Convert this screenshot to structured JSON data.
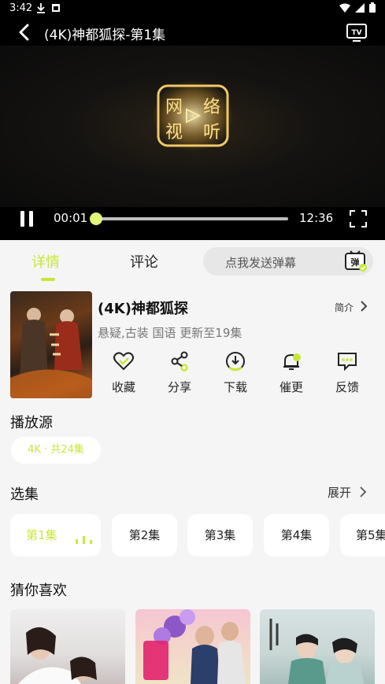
{
  "status_bar": {
    "time": "3:42"
  },
  "player": {
    "title": "(4K)神都狐探-第1集",
    "logo_text": "网络视听",
    "current_time": "00:01",
    "duration": "12:36",
    "progress": 0.002
  },
  "tabs": {
    "details": "详情",
    "comments": "评论",
    "danmu_placeholder": "点我发送弹幕",
    "danmu_icon_text": "弹"
  },
  "show": {
    "title": "(4K)神都狐探",
    "intro_label": "简介",
    "tags": "悬疑,古装 国语 更新至19集",
    "actions": [
      {
        "label": "收藏",
        "icon": "heart-icon"
      },
      {
        "label": "分享",
        "icon": "share-icon"
      },
      {
        "label": "下载",
        "icon": "download-icon"
      },
      {
        "label": "催更",
        "icon": "bell-icon"
      },
      {
        "label": "反馈",
        "icon": "feedback-icon"
      }
    ]
  },
  "source": {
    "title": "播放源",
    "chip": "4K · 共24集"
  },
  "episodes": {
    "title": "选集",
    "expand_label": "展开",
    "items": [
      "第1集",
      "第2集",
      "第3集",
      "第4集",
      "第5集"
    ]
  },
  "recommend": {
    "title": "猜你喜欢"
  },
  "colors": {
    "accent": "#c7e83a",
    "background": "#f5f5f5"
  }
}
